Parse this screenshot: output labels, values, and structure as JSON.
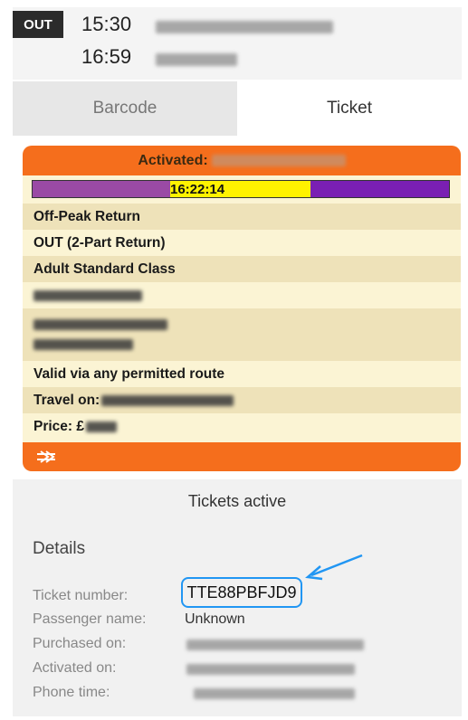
{
  "journey": {
    "direction": "OUT",
    "depart_time": "15:30",
    "arrive_time": "16:59"
  },
  "tabs": [
    {
      "label": "Barcode",
      "active": false
    },
    {
      "label": "Ticket",
      "active": true
    }
  ],
  "ticket": {
    "activated_label": "Activated:",
    "timer": "16:22:14",
    "fare_type": "Off-Peak Return",
    "leg": "OUT (2-Part Return)",
    "class": "Adult Standard Class",
    "route": "Valid via any permitted route",
    "travel_on_label": "Travel on:",
    "price_label": "Price: £",
    "rail_icon": "national-rail-icon"
  },
  "status": {
    "text": "Tickets active"
  },
  "details": {
    "title": "Details",
    "ticket_number_label": "Ticket number:",
    "ticket_number": "TTE88PBFJD9",
    "passenger_label": "Passenger name:",
    "passenger": "Unknown",
    "purchased_label": "Purchased on:",
    "activated_label": "Activated on:",
    "phone_time_label": "Phone time:"
  },
  "colors": {
    "brand_orange": "#f56e1c",
    "ticket_bg": "#fbf4d4",
    "highlight": "#2196f3"
  }
}
